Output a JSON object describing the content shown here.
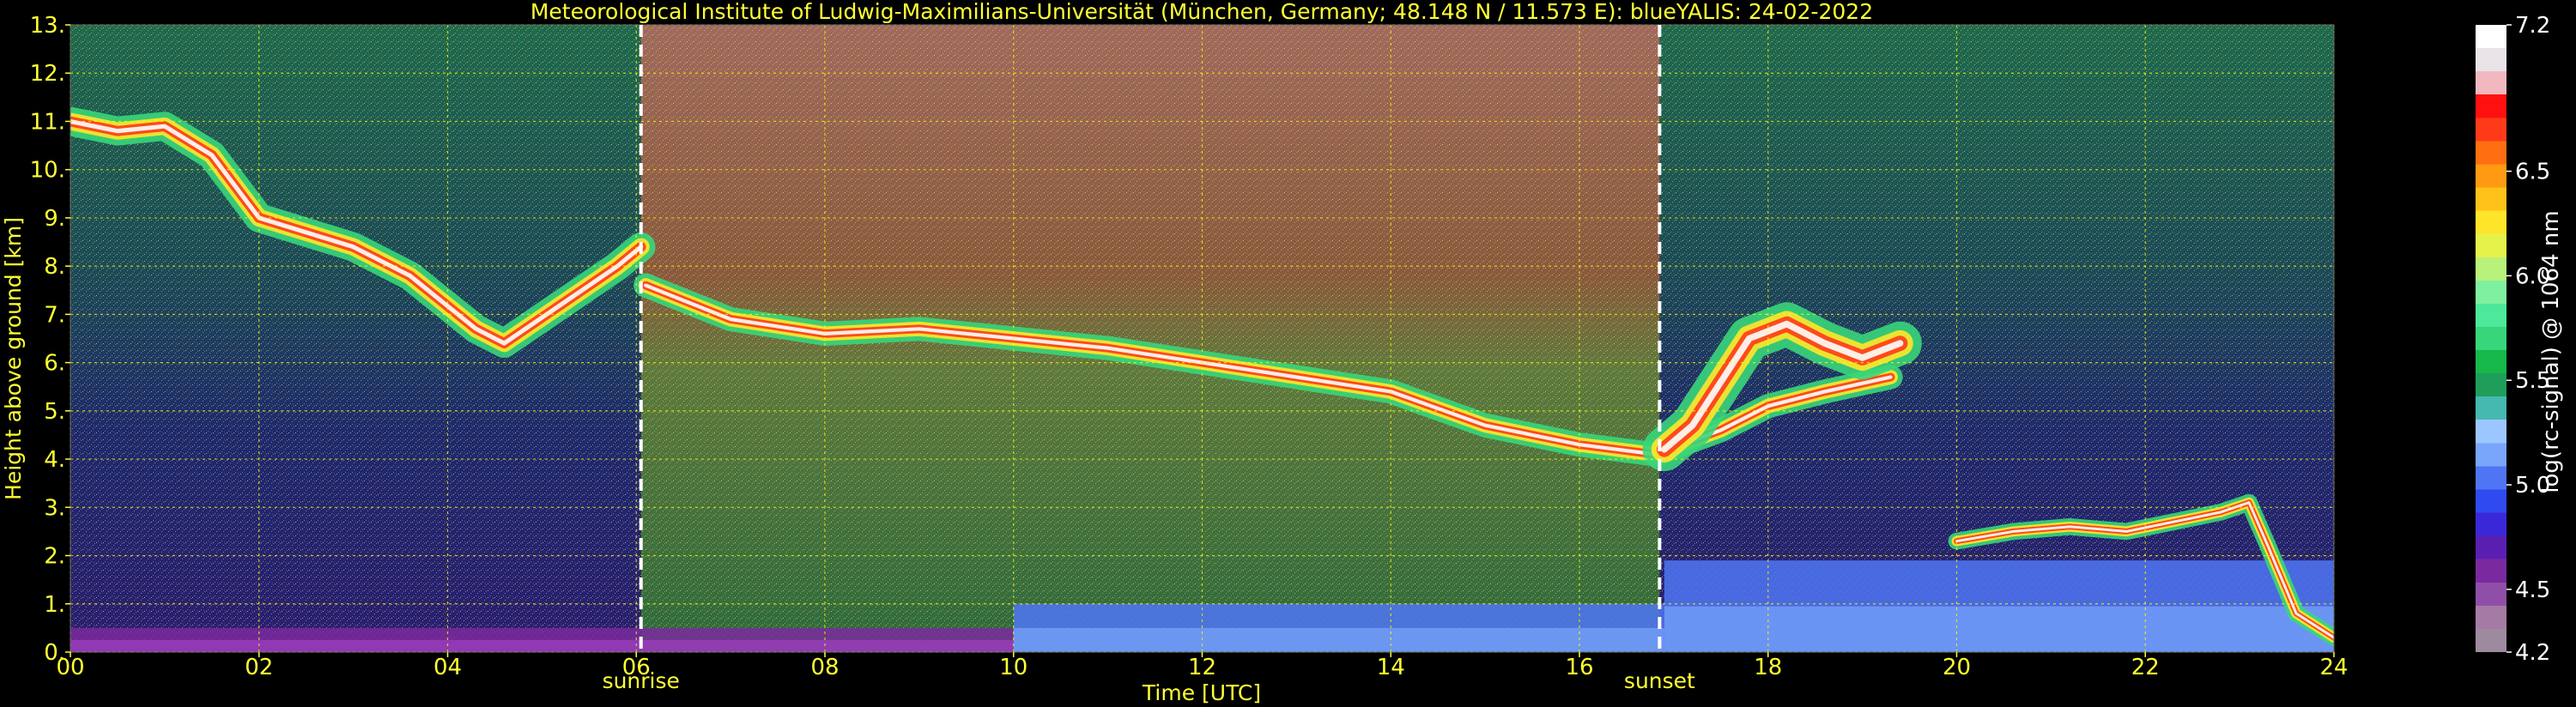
{
  "chart_data": {
    "type": "heatmap",
    "title": "Meteorological Institute of Ludwig-Maximilians-Universität (München, Germany; 48.148 N / 11.573 E):     blueYALIS: 24-02-2022",
    "xlabel": "Time [UTC]",
    "ylabel": "Height above ground [km]",
    "xlim": [
      0,
      24
    ],
    "ylim": [
      0,
      13
    ],
    "x_ticks": [
      0,
      2,
      4,
      6,
      8,
      10,
      12,
      14,
      16,
      18,
      20,
      22,
      24
    ],
    "x_tick_labels": [
      "00",
      "02",
      "04",
      "06",
      "08",
      "10",
      "12",
      "14",
      "16",
      "18",
      "20",
      "22",
      "24"
    ],
    "y_ticks": [
      0,
      1,
      2,
      3,
      4,
      5,
      6,
      7,
      8,
      9,
      10,
      11,
      12,
      13
    ],
    "y_tick_labels": [
      "0.",
      "1.",
      "2.",
      "3.",
      "4.",
      "5.",
      "6.",
      "7.",
      "8.",
      "9.",
      "10.",
      "11.",
      "12.",
      "13."
    ],
    "grid": true,
    "annotations": [
      {
        "label": "sunrise",
        "time": 6.05
      },
      {
        "label": "sunset",
        "time": 16.85
      }
    ],
    "colorbar": {
      "label": "log(rc-signal) @ 1064 nm",
      "range": [
        4.2,
        7.2
      ],
      "tick_values": [
        4.2,
        4.5,
        5.0,
        5.5,
        6.0,
        6.5,
        7.2
      ],
      "tick_labels": [
        "4.2",
        "4.5",
        "5.0",
        "5.5",
        "6.0",
        "6.5",
        "7.2"
      ],
      "colors": [
        "#9e8a9e",
        "#a47ba4",
        "#8f4fa8",
        "#7a2a9e",
        "#5a1fb0",
        "#3a28d8",
        "#2f4bf0",
        "#4f75f5",
        "#79a6fb",
        "#9cc6ff",
        "#45b8b0",
        "#1f9e5a",
        "#17b84a",
        "#38d67a",
        "#4de89a",
        "#7ff0a0",
        "#b8f27a",
        "#e6f24a",
        "#ffe52a",
        "#ffc21a",
        "#ff9a12",
        "#ff6e10",
        "#ff3a18",
        "#ff1010",
        "#f2b8c0",
        "#e8e4e8",
        "#ffffff"
      ]
    },
    "cloud_layers": [
      {
        "name_hidden": "cirrus-early",
        "points": [
          [
            0,
            11.0
          ],
          [
            0.5,
            10.8
          ],
          [
            1,
            10.9
          ],
          [
            1.5,
            10.3
          ],
          [
            2,
            9.0
          ],
          [
            3,
            8.4
          ],
          [
            3.6,
            7.8
          ],
          [
            4.3,
            6.7
          ],
          [
            4.6,
            6.4
          ],
          [
            5.2,
            7.2
          ],
          [
            5.8,
            8.0
          ],
          [
            6.05,
            8.4
          ]
        ],
        "thickness": 0.6
      },
      {
        "name_hidden": "aerosol-top-day",
        "points": [
          [
            6.1,
            7.6
          ],
          [
            7,
            6.9
          ],
          [
            8,
            6.6
          ],
          [
            9,
            6.7
          ],
          [
            10,
            6.5
          ],
          [
            11,
            6.3
          ],
          [
            12,
            6.0
          ],
          [
            13,
            5.7
          ],
          [
            14,
            5.4
          ],
          [
            15,
            4.7
          ],
          [
            16,
            4.3
          ],
          [
            16.8,
            4.1
          ],
          [
            17.5,
            4.6
          ],
          [
            18,
            5.1
          ],
          [
            18.6,
            5.4
          ],
          [
            19.3,
            5.7
          ]
        ],
        "thickness": 0.5
      },
      {
        "name_hidden": "evening-cloud",
        "points": [
          [
            16.9,
            4.2
          ],
          [
            17.2,
            4.7
          ],
          [
            17.5,
            5.6
          ],
          [
            17.8,
            6.5
          ],
          [
            18.2,
            6.8
          ],
          [
            18.6,
            6.4
          ],
          [
            19.0,
            6.1
          ],
          [
            19.4,
            6.4
          ]
        ],
        "thickness": 0.9
      },
      {
        "name_hidden": "low-cloud-night",
        "points": [
          [
            20,
            2.3
          ],
          [
            20.6,
            2.5
          ],
          [
            21.2,
            2.6
          ],
          [
            21.8,
            2.5
          ],
          [
            22.3,
            2.7
          ],
          [
            22.8,
            2.9
          ],
          [
            23.1,
            3.1
          ],
          [
            23.3,
            2.2
          ],
          [
            23.6,
            0.8
          ],
          [
            24,
            0.3
          ]
        ],
        "thickness": 0.35
      }
    ],
    "boundary_layer": [
      {
        "time_start": 0,
        "time_end": 10,
        "top": 0.5
      },
      {
        "time_start": 10,
        "time_end": 16.9,
        "top": 1.0
      },
      {
        "time_start": 16.9,
        "time_end": 24,
        "top": 1.9
      }
    ]
  }
}
